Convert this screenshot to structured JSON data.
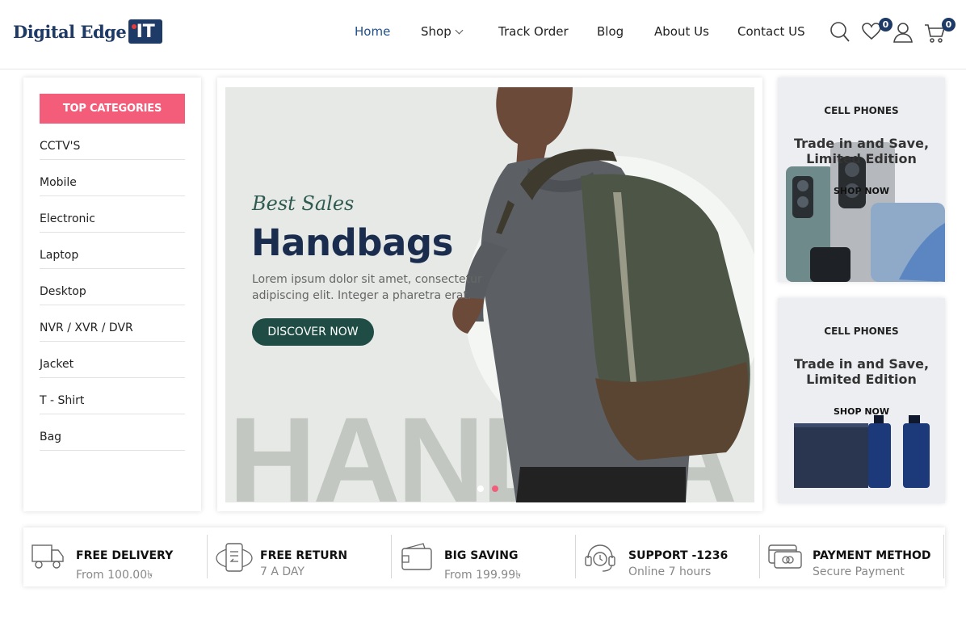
{
  "brand": {
    "logo_text": "Digital Edge",
    "logo_badge": "IT"
  },
  "nav": {
    "items": [
      {
        "label": "Home",
        "active": true
      },
      {
        "label": "Shop",
        "has_dropdown": true
      },
      {
        "label": "Track Order"
      },
      {
        "label": "Blog"
      },
      {
        "label": "About Us"
      },
      {
        "label": "Contact US"
      }
    ]
  },
  "header_icons": {
    "search": "search-icon",
    "wishlist": {
      "icon": "heart-icon",
      "count": "0"
    },
    "account": "user-icon",
    "cart": {
      "icon": "cart-icon",
      "count": "0"
    }
  },
  "sidebar": {
    "title": "TOP CATEGORIES",
    "items": [
      "CCTV'S",
      "Mobile",
      "Electronic",
      "Laptop",
      "Desktop",
      "NVR / XVR / DVR",
      "Jacket",
      "T - Shirt",
      "Bag"
    ]
  },
  "hero": {
    "script_text": "Best Sales",
    "title": "Handbags",
    "description": "Lorem ipsum dolor sit amet, consectetur adipiscing elit. Integer a pharetra erat.",
    "button": "DISCOVER NOW",
    "background_text": "HANDBA",
    "slides": 2,
    "active_slide": 2
  },
  "banners": [
    {
      "category": "CELL PHONES",
      "title": "Trade in and Save, Limited Edition",
      "cta": "SHOP NOW"
    },
    {
      "category": "CELL PHONES",
      "title": "Trade in and Save, Limited Edition",
      "cta": "SHOP NOW"
    }
  ],
  "features": [
    {
      "icon": "truck-icon",
      "title": "FREE DELIVERY",
      "subtitle": "From 100.00৳"
    },
    {
      "icon": "return-icon",
      "title": "FREE RETURN",
      "subtitle": "7 A DAY"
    },
    {
      "icon": "wallet-icon",
      "title": "BIG SAVING",
      "subtitle": "From 199.99৳"
    },
    {
      "icon": "headset-icon",
      "title": "SUPPORT -1236",
      "subtitle": "Online 7 hours"
    },
    {
      "icon": "credit-card-icon",
      "title": "PAYMENT METHOD",
      "subtitle": "Secure Payment"
    }
  ],
  "colors": {
    "brand": "#1e3a66",
    "accent": "#f45d7a",
    "button": "#1f4d45",
    "nav_active": "#1e4f8c"
  }
}
